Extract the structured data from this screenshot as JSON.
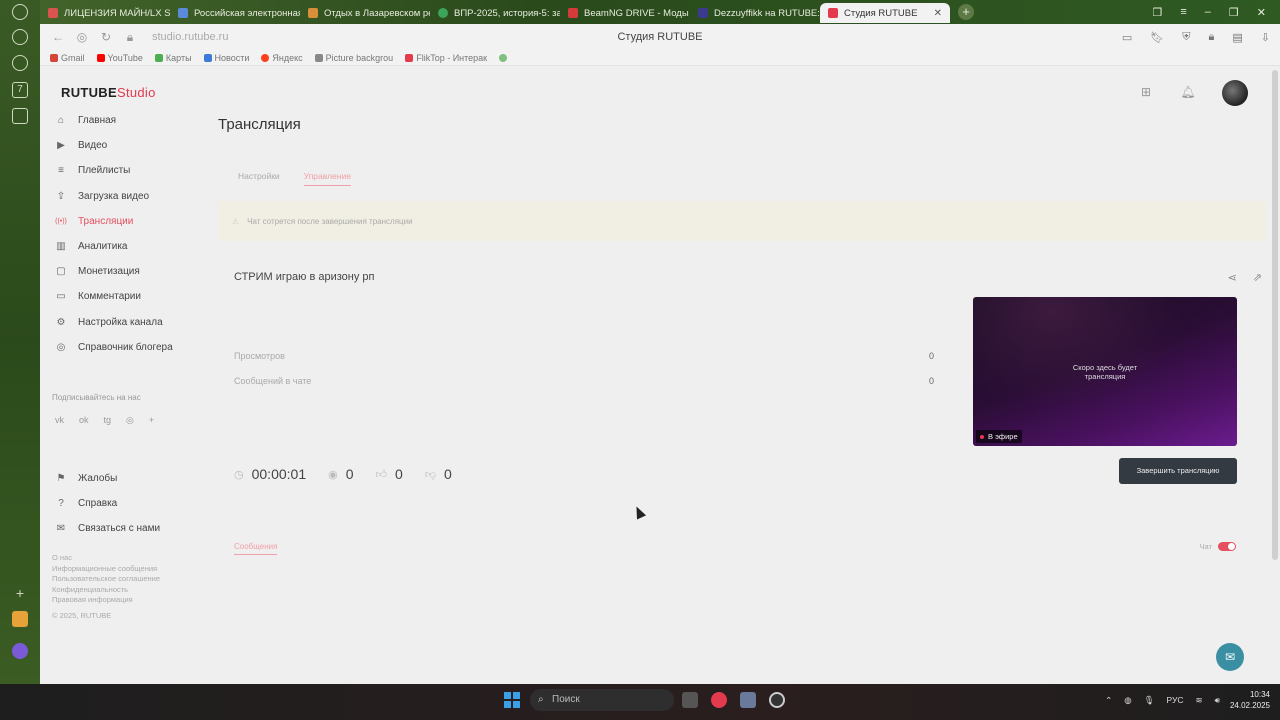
{
  "browser": {
    "tabs": [
      {
        "label": "ЛИЦЕНЗИЯ МАЙН/LX S",
        "color": "#d9534f"
      },
      {
        "label": "Российская электронная",
        "color": "#5b8bd8"
      },
      {
        "label": "Отдых в Лазаревском ре",
        "color": "#d98f3a"
      },
      {
        "label": "ВПР-2025, история-5: за",
        "color": "#3aa55b"
      },
      {
        "label": "BeamNG DRIVE - Моды",
        "color": "#d63a3a"
      },
      {
        "label": "Dezzuyffikk на RUTUBE: Z",
        "color": "#3a3a8f"
      },
      {
        "label": "Студия RUTUBE",
        "color": "#e33a4e",
        "active": true,
        "close": "✕"
      }
    ],
    "url": "studio.rutube.ru",
    "page_title": "Студия RUTUBE",
    "bookmarks": [
      {
        "label": "Gmail",
        "color": "#d44638"
      },
      {
        "label": "YouTube",
        "color": "#ff0000"
      },
      {
        "label": "Карты",
        "color": "#4caf50"
      },
      {
        "label": "Новости",
        "color": "#3f7ad8"
      },
      {
        "label": "Яндекс",
        "color": "#fc3f1d"
      },
      {
        "label": "Picture backgrou",
        "color": "#888888"
      },
      {
        "label": "FlikTop - Интерак",
        "color": "#e33a4e"
      }
    ],
    "strip_badge": "7"
  },
  "studio": {
    "logo_main": "RUTUBE",
    "logo_sub": "Studio",
    "nav": [
      {
        "label": "Главная",
        "icon": "⌂"
      },
      {
        "label": "Видео",
        "icon": "▶"
      },
      {
        "label": "Плейлисты",
        "icon": "≡"
      },
      {
        "label": "Загрузка видео",
        "icon": "⇪"
      },
      {
        "label": "Трансляции",
        "icon": "((•))",
        "active": true
      },
      {
        "label": "Аналитика",
        "icon": "▥"
      },
      {
        "label": "Монетизация",
        "icon": "▢"
      },
      {
        "label": "Комментарии",
        "icon": "▭"
      },
      {
        "label": "Настройка канала",
        "icon": "⚙"
      },
      {
        "label": "Справочник блогера",
        "icon": "◎"
      }
    ],
    "subscribe_label": "Подписывайтесь на нас",
    "socials": [
      "vk",
      "ok",
      "tg",
      "◎",
      "+"
    ],
    "nav2": [
      {
        "label": "Жалобы",
        "icon": "⚑"
      },
      {
        "label": "Справка",
        "icon": "?"
      },
      {
        "label": "Связаться с нами",
        "icon": "✉"
      }
    ],
    "footer_links": [
      "О нас",
      "Информационные сообщения",
      "Пользовательское соглашение",
      "Конфиденциальность",
      "Правовая информация",
      "© 2025, RUTUBE"
    ]
  },
  "content": {
    "title": "Трансляция",
    "tabs": [
      {
        "label": "Настройки"
      },
      {
        "label": "Управление",
        "active": true
      }
    ],
    "notice": "Чат сотрется после завершения трансляции",
    "stream_title": "СТРИМ играю в аризону рп",
    "stats": [
      {
        "label": "Просмотров",
        "value": "0"
      },
      {
        "label": "Сообщений в чате",
        "value": "0"
      }
    ],
    "preview_text_line1": "Скоро здесь будет",
    "preview_text_line2": "трансляция",
    "live_label": "В эфире",
    "timer": "00:00:01",
    "viewers": "0",
    "likes": "0",
    "dislikes": "0",
    "end_button": "Завершить трансляцию",
    "messages_tab": "Сообщения",
    "chat_label": "Чат",
    "chat_enabled": true
  },
  "taskbar": {
    "search": "Поиск",
    "lang": "РУС",
    "time": "10:34",
    "date": "24.02.2025"
  }
}
